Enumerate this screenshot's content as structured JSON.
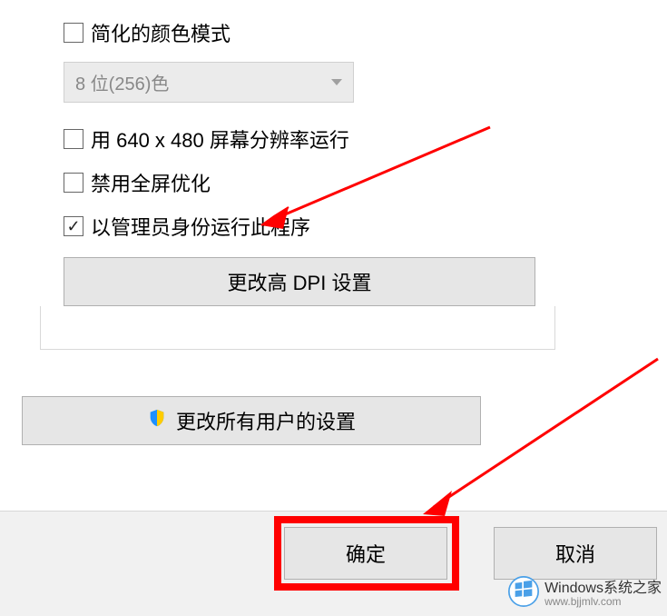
{
  "settings": {
    "reduced_color_mode": {
      "label": "简化的颜色模式",
      "checked": false
    },
    "color_depth": {
      "selected": "8 位(256)色",
      "enabled": false
    },
    "low_resolution": {
      "label": "用 640 x 480 屏幕分辨率运行",
      "checked": false
    },
    "disable_fullscreen_opt": {
      "label": "禁用全屏优化",
      "checked": false
    },
    "run_as_admin": {
      "label": "以管理员身份运行此程序",
      "checked": true
    },
    "dpi_button_label": "更改高 DPI 设置",
    "all_users_button_label": "更改所有用户的设置"
  },
  "buttons": {
    "ok": "确定",
    "cancel": "取消"
  },
  "annotation": {
    "arrow_color": "#ff0000",
    "highlight_color": "#ff0000"
  },
  "watermark": {
    "title": "Windows系统之家",
    "url": "www.bjjmlv.com"
  }
}
